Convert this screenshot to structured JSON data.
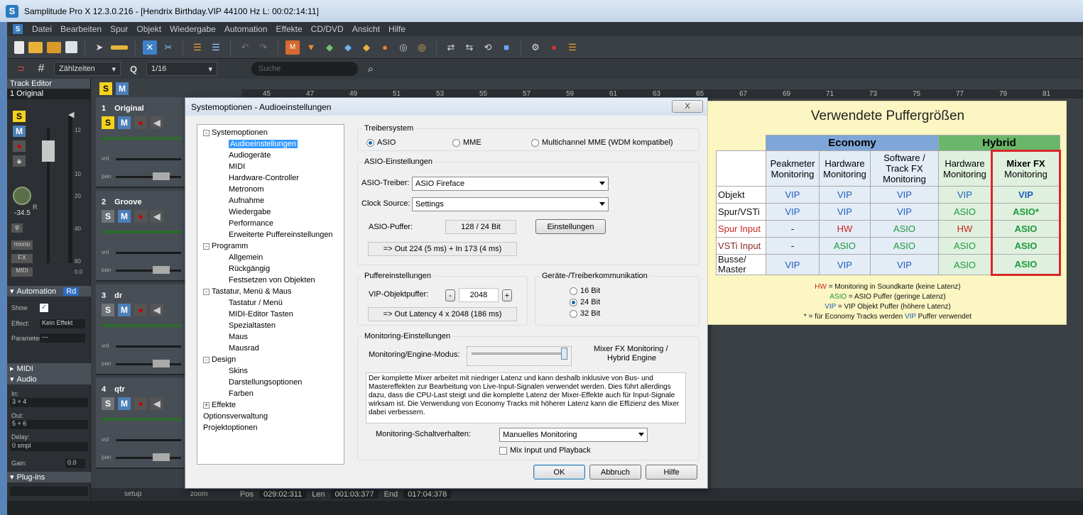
{
  "window": {
    "title": "Samplitude Pro X 12.3.0.216 - [Hendrix Birthday.VIP   44100 Hz L: 00:02:14:11]",
    "logo_letter": "S"
  },
  "menu": [
    "Datei",
    "Bearbeiten",
    "Spur",
    "Objekt",
    "Wiedergabe",
    "Automation",
    "Effekte",
    "CD/DVD",
    "Ansicht",
    "Hilfe"
  ],
  "toolbar2": {
    "grid_mode": "Zählzeiten",
    "quantize": "1/16",
    "search_placeholder": "Suche"
  },
  "track_editor": {
    "header": "Track Editor",
    "selected_track": "1  Original",
    "automation_label": "Automation",
    "rd_label": "Rd",
    "show_label": "Show",
    "effect_label": "Effect:",
    "effect_value": "Kein Effekt",
    "parameter_label": "Parameter",
    "parameter_value": "---",
    "midi_label": "MIDI",
    "audio_label": "Audio",
    "in_label": "In:",
    "in_value": "3 + 4",
    "out_label": "Out:",
    "out_value": "5 + 6",
    "delay_label": "Delay:",
    "delay_value": "0 smpl",
    "gain_label": "Gain:",
    "gain_value": "0.0",
    "plugins_label": "Plug-ins",
    "pan_value": "-34.5",
    "pan_r": "R",
    "mono_label": "mono",
    "fx_label": "FX",
    "midi_btn": "MIDI",
    "meter_ticks": [
      "12",
      "10",
      "20",
      "40",
      "80",
      "0.0"
    ]
  },
  "tracks": [
    {
      "number": "1",
      "name": "Original",
      "solo_on": true
    },
    {
      "number": "2",
      "name": "Groove",
      "solo_on": false
    },
    {
      "number": "3",
      "name": "dr",
      "solo_on": false
    },
    {
      "number": "4",
      "name": "qtr",
      "solo_on": false
    }
  ],
  "track_labels": {
    "vol": "vol",
    "pan": "pan"
  },
  "timeline_ticks": [
    "45",
    "47",
    "49",
    "51",
    "53",
    "55",
    "57",
    "59",
    "61",
    "63",
    "65",
    "67",
    "69",
    "71",
    "73",
    "75",
    "77",
    "79",
    "81"
  ],
  "bottombar": {
    "pos_label": "Pos",
    "pos_value": "029:02:311",
    "len_label": "Len",
    "len_value": "001:03:377",
    "end_label": "End",
    "end_value": "017:04:378",
    "setup": "setup",
    "zoom": "zoom"
  },
  "dialog": {
    "title": "Systemoptionen - Audioeinstellungen",
    "close_label": "X",
    "tree": [
      {
        "label": "Systemoptionen",
        "level": 0,
        "expander": "-"
      },
      {
        "label": "Audioeinstellungen",
        "level": 1,
        "selected": true
      },
      {
        "label": "Audiogeräte",
        "level": 1
      },
      {
        "label": "MIDI",
        "level": 1
      },
      {
        "label": "Hardware-Controller",
        "level": 1
      },
      {
        "label": "Metronom",
        "level": 1
      },
      {
        "label": "Aufnahme",
        "level": 1
      },
      {
        "label": "Wiedergabe",
        "level": 1
      },
      {
        "label": "Performance",
        "level": 1
      },
      {
        "label": "Erweiterte Puffereinstellungen",
        "level": 1
      },
      {
        "label": "Programm",
        "level": 0,
        "expander": "-"
      },
      {
        "label": "Allgemein",
        "level": 1
      },
      {
        "label": "Rückgängig",
        "level": 1
      },
      {
        "label": "Festsetzen von Objekten",
        "level": 1
      },
      {
        "label": "Tastatur, Menü & Maus",
        "level": 0,
        "expander": "-"
      },
      {
        "label": "Tastatur / Menü",
        "level": 1
      },
      {
        "label": "MIDI-Editor Tasten",
        "level": 1
      },
      {
        "label": "Spezialtasten",
        "level": 1
      },
      {
        "label": "Maus",
        "level": 1
      },
      {
        "label": "Mausrad",
        "level": 1
      },
      {
        "label": "Design",
        "level": 0,
        "expander": "-"
      },
      {
        "label": "Skins",
        "level": 1
      },
      {
        "label": "Darstellungsoptionen",
        "level": 1
      },
      {
        "label": "Farben",
        "level": 1
      },
      {
        "label": "Effekte",
        "level": 0,
        "expander": "+"
      },
      {
        "label": "Optionsverwaltung",
        "level": 0
      },
      {
        "label": "Projektoptionen",
        "level": 0
      }
    ],
    "driver_group": "Treibersystem",
    "driver_options": [
      "ASIO",
      "MME",
      "Multichannel MME (WDM kompatibel)"
    ],
    "driver_selected": "ASIO",
    "asio_group": "ASIO-Einstellungen",
    "asio_driver_label": "ASIO-Treiber:",
    "asio_driver_value": "ASIO Fireface",
    "clock_label": "Clock Source:",
    "clock_value": "Settings",
    "asio_buffer_label": "ASIO-Puffer:",
    "asio_buffer_value": "128 / 24 Bit",
    "settings_button": "Einstellungen",
    "asio_latency": "=> Out 224 (5 ms) + In 173 (4 ms)",
    "buffer_group": "Puffereinstellungen",
    "vip_buffer_label": "VIP-Objektpuffer:",
    "vip_buffer_value": "2048",
    "minus": "-",
    "plus": "+",
    "vip_latency": "=> Out Latency 4 x 2048 (186 ms)",
    "device_group": "Geräte-/Treiberkommunikation",
    "bit_options": [
      "16 Bit",
      "24 Bit",
      "32 Bit"
    ],
    "bit_selected": "24 Bit",
    "monitoring_group": "Monitoring-Einstellungen",
    "engine_label": "Monitoring/Engine-Modus:",
    "engine_value_line1": "Mixer FX Monitoring /",
    "engine_value_line2": "Hybrid Engine",
    "engine_slider_level": 1.0,
    "description": "Der komplette Mixer arbeitet mit niedriger Latenz und kann deshalb inklusive von Bus- und Mastereffekten zur Bearbeitung von Live-Input-Signalen verwendet werden. Dies führt allerdings dazu, dass die CPU-Last steigt und die komplette Latenz der Mixer-Effekte auch für Input-Signale wirksam ist. Die Verwendung von Economy Tracks mit höherer Latenz kann die Effizienz des Mixer dabei verbessern.",
    "switch_label": "Monitoring-Schaltverhalten:",
    "switch_value": "Manuelles Monitoring",
    "mix_input_label": "Mix Input und Playback",
    "ok": "OK",
    "cancel": "Abbruch",
    "help": "Hilfe"
  },
  "info_panel": {
    "title": "Verwendete Puffergrößen",
    "economy": "Economy",
    "hybrid": "Hybrid",
    "columns": [
      [
        "Peakmeter",
        "Monitoring"
      ],
      [
        "Hardware",
        "Monitoring"
      ],
      [
        "Software /",
        "Track FX",
        "Monitoring"
      ],
      [
        "Hardware",
        "Monitoring"
      ],
      [
        "Mixer FX",
        "Monitoring"
      ]
    ],
    "rows": [
      {
        "label": "Objekt",
        "cells": [
          "VIP",
          "VIP",
          "VIP",
          "VIP",
          "VIP"
        ]
      },
      {
        "label": "Spur/VSTi",
        "cells": [
          "VIP",
          "VIP",
          "VIP",
          "ASIO",
          "ASIO*"
        ]
      },
      {
        "label": "Spur Input",
        "cells": [
          "-",
          "HW",
          "ASIO",
          "HW",
          "ASIO"
        ]
      },
      {
        "label": "VSTi Input",
        "cells": [
          "-",
          "ASIO",
          "ASIO",
          "ASIO",
          "ASIO"
        ]
      },
      {
        "label": "Busse/ Master",
        "cells": [
          "VIP",
          "VIP",
          "VIP",
          "ASIO",
          "ASIO"
        ]
      }
    ],
    "legend": [
      {
        "key": "HW",
        "text": " = Monitoring in Soundkarte (keine Latenz)"
      },
      {
        "key": "ASIO",
        "text": " = ASIO Puffer (geringe Latenz)"
      },
      {
        "key": "VIP",
        "text": " = VIP Objekt Puffer (höhere Latenz)"
      }
    ],
    "footnote_pre": "* = für Economy Tracks werden ",
    "footnote_key": "VIP",
    "footnote_post": " Puffer verwendet",
    "colors": {
      "vip": "#1f5fbf",
      "asio": "#1d9a3a",
      "hw": "#c8281e",
      "economy_head": "#7ea6d8",
      "hybrid_head": "#6ab66a",
      "highlight": "#d8282a"
    }
  }
}
